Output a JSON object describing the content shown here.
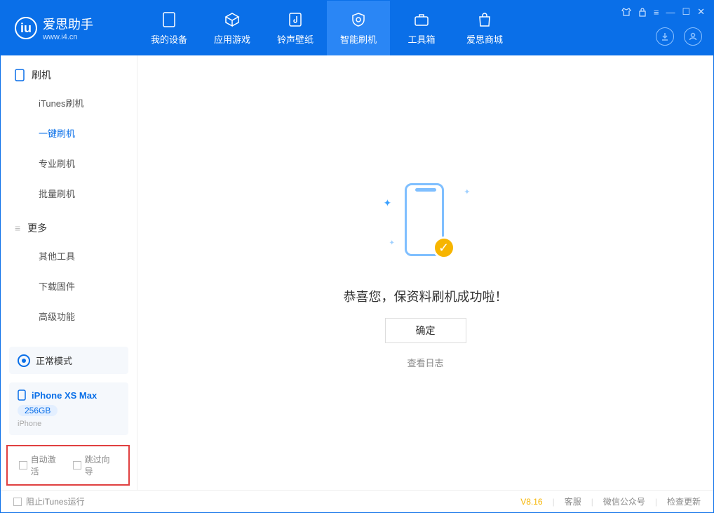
{
  "app": {
    "title": "爱思助手",
    "url": "www.i4.cn"
  },
  "nav": {
    "my_device": "我的设备",
    "apps_games": "应用游戏",
    "ringtones": "铃声壁纸",
    "smart_flash": "智能刷机",
    "toolbox": "工具箱",
    "store": "爱思商城"
  },
  "sidebar": {
    "section_flash": "刷机",
    "itunes_flash": "iTunes刷机",
    "one_click_flash": "一键刷机",
    "pro_flash": "专业刷机",
    "batch_flash": "批量刷机",
    "section_more": "更多",
    "other_tools": "其他工具",
    "download_fw": "下载固件",
    "advanced": "高级功能"
  },
  "mode": {
    "label": "正常模式"
  },
  "device": {
    "name": "iPhone XS Max",
    "capacity": "256GB",
    "type": "iPhone"
  },
  "options": {
    "auto_activate": "自动激活",
    "skip_guide": "跳过向导"
  },
  "main": {
    "message": "恭喜您，保资料刷机成功啦！",
    "ok": "确定",
    "view_log": "查看日志"
  },
  "footer": {
    "block_itunes": "阻止iTunes运行",
    "version": "V8.16",
    "support": "客服",
    "wechat": "微信公众号",
    "check_update": "检查更新"
  }
}
